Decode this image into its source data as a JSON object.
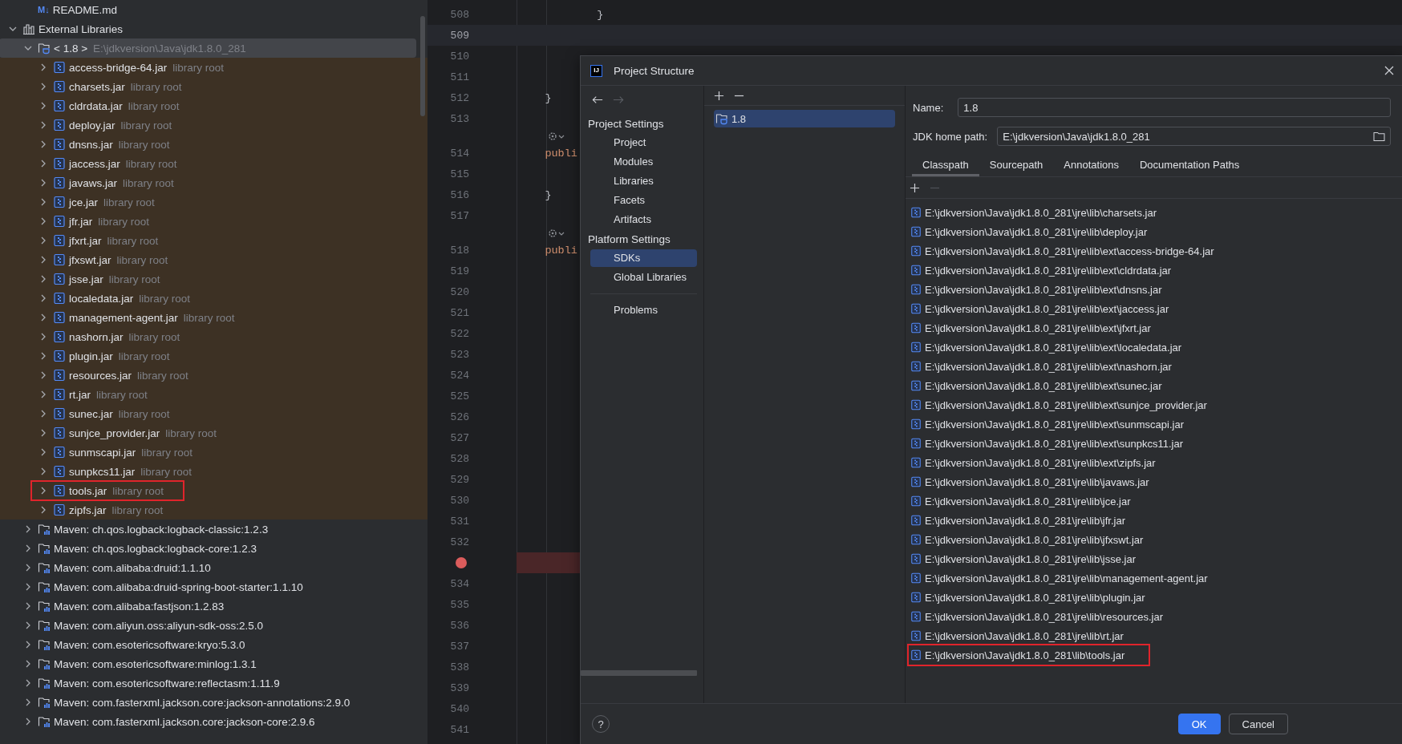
{
  "project_tree": {
    "files": [
      {
        "icon_text": "M↓",
        "label": "README.md"
      }
    ],
    "nodes": [
      {
        "label": "External Libraries",
        "kind": "libraries",
        "expanded": true,
        "selected": false,
        "children": [
          {
            "label": "< 1.8 >",
            "hint": "E:\\jdkversion\\Java\\jdk1.8.0_281",
            "kind": "sdk",
            "expanded": true,
            "selected": true,
            "children": [
              {
                "label": "access-bridge-64.jar",
                "hint": "library root",
                "kind": "jar",
                "expanded": false,
                "selected": false,
                "highlighted": false
              },
              {
                "label": "charsets.jar",
                "hint": "library root",
                "kind": "jar",
                "expanded": false,
                "selected": false,
                "highlighted": false
              },
              {
                "label": "cldrdata.jar",
                "hint": "library root",
                "kind": "jar",
                "expanded": false,
                "selected": false,
                "highlighted": false
              },
              {
                "label": "deploy.jar",
                "hint": "library root",
                "kind": "jar",
                "expanded": false,
                "selected": false,
                "highlighted": false
              },
              {
                "label": "dnsns.jar",
                "hint": "library root",
                "kind": "jar",
                "expanded": false,
                "selected": false,
                "highlighted": false
              },
              {
                "label": "jaccess.jar",
                "hint": "library root",
                "kind": "jar",
                "expanded": false,
                "selected": false,
                "highlighted": false
              },
              {
                "label": "javaws.jar",
                "hint": "library root",
                "kind": "jar",
                "expanded": false,
                "selected": false,
                "highlighted": false
              },
              {
                "label": "jce.jar",
                "hint": "library root",
                "kind": "jar",
                "expanded": false,
                "selected": false,
                "highlighted": false
              },
              {
                "label": "jfr.jar",
                "hint": "library root",
                "kind": "jar",
                "expanded": false,
                "selected": false,
                "highlighted": false
              },
              {
                "label": "jfxrt.jar",
                "hint": "library root",
                "kind": "jar",
                "expanded": false,
                "selected": false,
                "highlighted": false
              },
              {
                "label": "jfxswt.jar",
                "hint": "library root",
                "kind": "jar",
                "expanded": false,
                "selected": false,
                "highlighted": false
              },
              {
                "label": "jsse.jar",
                "hint": "library root",
                "kind": "jar",
                "expanded": false,
                "selected": false,
                "highlighted": false
              },
              {
                "label": "localedata.jar",
                "hint": "library root",
                "kind": "jar",
                "expanded": false,
                "selected": false,
                "highlighted": false
              },
              {
                "label": "management-agent.jar",
                "hint": "library root",
                "kind": "jar",
                "expanded": false,
                "selected": false,
                "highlighted": false
              },
              {
                "label": "nashorn.jar",
                "hint": "library root",
                "kind": "jar",
                "expanded": false,
                "selected": false,
                "highlighted": false
              },
              {
                "label": "plugin.jar",
                "hint": "library root",
                "kind": "jar",
                "expanded": false,
                "selected": false,
                "highlighted": false
              },
              {
                "label": "resources.jar",
                "hint": "library root",
                "kind": "jar",
                "expanded": false,
                "selected": false,
                "highlighted": false
              },
              {
                "label": "rt.jar",
                "hint": "library root",
                "kind": "jar",
                "expanded": false,
                "selected": false,
                "highlighted": false
              },
              {
                "label": "sunec.jar",
                "hint": "library root",
                "kind": "jar",
                "expanded": false,
                "selected": false,
                "highlighted": false
              },
              {
                "label": "sunjce_provider.jar",
                "hint": "library root",
                "kind": "jar",
                "expanded": false,
                "selected": false,
                "highlighted": false
              },
              {
                "label": "sunmscapi.jar",
                "hint": "library root",
                "kind": "jar",
                "expanded": false,
                "selected": false,
                "highlighted": false
              },
              {
                "label": "sunpkcs11.jar",
                "hint": "library root",
                "kind": "jar",
                "expanded": false,
                "selected": false,
                "highlighted": false
              },
              {
                "label": "tools.jar",
                "hint": "library root",
                "kind": "jar",
                "expanded": false,
                "selected": false,
                "highlighted": true
              },
              {
                "label": "zipfs.jar",
                "hint": "library root",
                "kind": "jar",
                "expanded": false,
                "selected": false,
                "highlighted": false
              }
            ]
          },
          {
            "label": "Maven: ch.qos.logback:logback-classic:1.2.3",
            "kind": "maven",
            "expanded": false,
            "selected": false
          },
          {
            "label": "Maven: ch.qos.logback:logback-core:1.2.3",
            "kind": "maven",
            "expanded": false,
            "selected": false
          },
          {
            "label": "Maven: com.alibaba:druid:1.1.10",
            "kind": "maven",
            "expanded": false,
            "selected": false
          },
          {
            "label": "Maven: com.alibaba:druid-spring-boot-starter:1.1.10",
            "kind": "maven",
            "expanded": false,
            "selected": false
          },
          {
            "label": "Maven: com.alibaba:fastjson:1.2.83",
            "kind": "maven",
            "expanded": false,
            "selected": false
          },
          {
            "label": "Maven: com.aliyun.oss:aliyun-sdk-oss:2.5.0",
            "kind": "maven",
            "expanded": false,
            "selected": false
          },
          {
            "label": "Maven: com.esotericsoftware:kryo:5.3.0",
            "kind": "maven",
            "expanded": false,
            "selected": false
          },
          {
            "label": "Maven: com.esotericsoftware:minlog:1.3.1",
            "kind": "maven",
            "expanded": false,
            "selected": false
          },
          {
            "label": "Maven: com.esotericsoftware:reflectasm:1.11.9",
            "kind": "maven",
            "expanded": false,
            "selected": false
          },
          {
            "label": "Maven: com.fasterxml.jackson.core:jackson-annotations:2.9.0",
            "kind": "maven",
            "expanded": false,
            "selected": false
          },
          {
            "label": "Maven: com.fasterxml.jackson.core:jackson-core:2.9.6",
            "kind": "maven",
            "expanded": false,
            "selected": false
          }
        ]
      }
    ]
  },
  "editor": {
    "lines": [
      {
        "kind": "line",
        "number": "508",
        "code": "            }",
        "current": false,
        "breakpoint": false
      },
      {
        "kind": "line",
        "number": "509",
        "current": true,
        "breakpoint": false
      },
      {
        "kind": "line",
        "number": "510",
        "current": false,
        "breakpoint": false
      },
      {
        "kind": "line",
        "number": "511",
        "current": false,
        "breakpoint": false
      },
      {
        "kind": "line",
        "number": "512",
        "code": "    }",
        "current": false,
        "breakpoint": false
      },
      {
        "kind": "line",
        "number": "513",
        "current": false,
        "breakpoint": false
      },
      {
        "kind": "inlay"
      },
      {
        "kind": "line",
        "number": "514",
        "code": "    publi",
        "current": false,
        "breakpoint": false
      },
      {
        "kind": "line",
        "number": "515",
        "current": false,
        "breakpoint": false
      },
      {
        "kind": "line",
        "number": "516",
        "code": "    }",
        "current": false,
        "breakpoint": false
      },
      {
        "kind": "line",
        "number": "517",
        "current": false,
        "breakpoint": false
      },
      {
        "kind": "inlay"
      },
      {
        "kind": "line",
        "number": "518",
        "code": "    publi",
        "current": false,
        "breakpoint": false
      },
      {
        "kind": "line",
        "number": "519",
        "current": false,
        "breakpoint": false
      },
      {
        "kind": "line",
        "number": "520",
        "current": false,
        "breakpoint": false
      },
      {
        "kind": "line",
        "number": "521",
        "current": false,
        "breakpoint": false
      },
      {
        "kind": "line",
        "number": "522",
        "current": false,
        "breakpoint": false
      },
      {
        "kind": "line",
        "number": "523",
        "current": false,
        "breakpoint": false
      },
      {
        "kind": "line",
        "number": "524",
        "current": false,
        "breakpoint": false
      },
      {
        "kind": "line",
        "number": "525",
        "current": false,
        "breakpoint": false
      },
      {
        "kind": "line",
        "number": "526",
        "current": false,
        "breakpoint": false
      },
      {
        "kind": "line",
        "number": "527",
        "current": false,
        "breakpoint": false
      },
      {
        "kind": "line",
        "number": "528",
        "current": false,
        "breakpoint": false
      },
      {
        "kind": "line",
        "number": "529",
        "current": false,
        "breakpoint": false
      },
      {
        "kind": "line",
        "number": "530",
        "current": false,
        "breakpoint": false
      },
      {
        "kind": "line",
        "number": "531",
        "current": false,
        "breakpoint": false
      },
      {
        "kind": "line",
        "number": "532",
        "current": false,
        "breakpoint": false
      },
      {
        "kind": "line",
        "current": false,
        "breakpoint": true
      },
      {
        "kind": "line",
        "number": "534",
        "current": false,
        "breakpoint": false
      },
      {
        "kind": "line",
        "number": "535",
        "current": false,
        "breakpoint": false
      },
      {
        "kind": "line",
        "number": "536",
        "current": false,
        "breakpoint": false
      },
      {
        "kind": "line",
        "number": "537",
        "current": false,
        "breakpoint": false
      },
      {
        "kind": "line",
        "number": "538",
        "current": false,
        "breakpoint": false
      },
      {
        "kind": "line",
        "number": "539",
        "current": false,
        "breakpoint": false
      },
      {
        "kind": "line",
        "number": "540",
        "current": false,
        "breakpoint": false
      },
      {
        "kind": "line",
        "number": "541",
        "current": false,
        "breakpoint": false
      }
    ]
  },
  "dialog": {
    "logo_text": "IJ",
    "title": "Project Structure",
    "history": {
      "back_enabled": true,
      "forward_enabled": false
    },
    "nav": [
      {
        "heading": "Project Settings",
        "items": [
          {
            "label": "Project",
            "selected": false
          },
          {
            "label": "Modules",
            "selected": false
          },
          {
            "label": "Libraries",
            "selected": false
          },
          {
            "label": "Facets",
            "selected": false
          },
          {
            "label": "Artifacts",
            "selected": false
          }
        ]
      },
      {
        "heading": "Platform Settings",
        "items": [
          {
            "label": "SDKs",
            "selected": true
          },
          {
            "label": "Global Libraries",
            "selected": false
          }
        ]
      },
      {
        "items": [
          {
            "label": "Problems",
            "selected": false
          }
        ]
      }
    ],
    "sdk_toolbar": {
      "remove_enabled": true
    },
    "sdk_list": [
      {
        "label": "1.8",
        "selected": true
      }
    ],
    "name_field": {
      "label": "Name:",
      "value": "1.8"
    },
    "home_path_field": {
      "label": "JDK home path:",
      "value": "E:\\jdkversion\\Java\\jdk1.8.0_281"
    },
    "tabs": [
      {
        "label": "Classpath",
        "selected": true
      },
      {
        "label": "Sourcepath",
        "selected": false
      },
      {
        "label": "Annotations",
        "selected": false
      },
      {
        "label": "Documentation Paths",
        "selected": false
      }
    ],
    "classpath_toolbar": {
      "remove_enabled": false
    },
    "classpath": [
      {
        "path": "E:\\jdkversion\\Java\\jdk1.8.0_281\\jre\\lib\\charsets.jar",
        "highlighted": false
      },
      {
        "path": "E:\\jdkversion\\Java\\jdk1.8.0_281\\jre\\lib\\deploy.jar",
        "highlighted": false
      },
      {
        "path": "E:\\jdkversion\\Java\\jdk1.8.0_281\\jre\\lib\\ext\\access-bridge-64.jar",
        "highlighted": false
      },
      {
        "path": "E:\\jdkversion\\Java\\jdk1.8.0_281\\jre\\lib\\ext\\cldrdata.jar",
        "highlighted": false
      },
      {
        "path": "E:\\jdkversion\\Java\\jdk1.8.0_281\\jre\\lib\\ext\\dnsns.jar",
        "highlighted": false
      },
      {
        "path": "E:\\jdkversion\\Java\\jdk1.8.0_281\\jre\\lib\\ext\\jaccess.jar",
        "highlighted": false
      },
      {
        "path": "E:\\jdkversion\\Java\\jdk1.8.0_281\\jre\\lib\\ext\\jfxrt.jar",
        "highlighted": false
      },
      {
        "path": "E:\\jdkversion\\Java\\jdk1.8.0_281\\jre\\lib\\ext\\localedata.jar",
        "highlighted": false
      },
      {
        "path": "E:\\jdkversion\\Java\\jdk1.8.0_281\\jre\\lib\\ext\\nashorn.jar",
        "highlighted": false
      },
      {
        "path": "E:\\jdkversion\\Java\\jdk1.8.0_281\\jre\\lib\\ext\\sunec.jar",
        "highlighted": false
      },
      {
        "path": "E:\\jdkversion\\Java\\jdk1.8.0_281\\jre\\lib\\ext\\sunjce_provider.jar",
        "highlighted": false
      },
      {
        "path": "E:\\jdkversion\\Java\\jdk1.8.0_281\\jre\\lib\\ext\\sunmscapi.jar",
        "highlighted": false
      },
      {
        "path": "E:\\jdkversion\\Java\\jdk1.8.0_281\\jre\\lib\\ext\\sunpkcs11.jar",
        "highlighted": false
      },
      {
        "path": "E:\\jdkversion\\Java\\jdk1.8.0_281\\jre\\lib\\ext\\zipfs.jar",
        "highlighted": false
      },
      {
        "path": "E:\\jdkversion\\Java\\jdk1.8.0_281\\jre\\lib\\javaws.jar",
        "highlighted": false
      },
      {
        "path": "E:\\jdkversion\\Java\\jdk1.8.0_281\\jre\\lib\\jce.jar",
        "highlighted": false
      },
      {
        "path": "E:\\jdkversion\\Java\\jdk1.8.0_281\\jre\\lib\\jfr.jar",
        "highlighted": false
      },
      {
        "path": "E:\\jdkversion\\Java\\jdk1.8.0_281\\jre\\lib\\jfxswt.jar",
        "highlighted": false
      },
      {
        "path": "E:\\jdkversion\\Java\\jdk1.8.0_281\\jre\\lib\\jsse.jar",
        "highlighted": false
      },
      {
        "path": "E:\\jdkversion\\Java\\jdk1.8.0_281\\jre\\lib\\management-agent.jar",
        "highlighted": false
      },
      {
        "path": "E:\\jdkversion\\Java\\jdk1.8.0_281\\jre\\lib\\plugin.jar",
        "highlighted": false
      },
      {
        "path": "E:\\jdkversion\\Java\\jdk1.8.0_281\\jre\\lib\\resources.jar",
        "highlighted": false
      },
      {
        "path": "E:\\jdkversion\\Java\\jdk1.8.0_281\\jre\\lib\\rt.jar",
        "highlighted": false
      },
      {
        "path": "E:\\jdkversion\\Java\\jdk1.8.0_281\\lib\\tools.jar",
        "highlighted": true
      }
    ],
    "help": "?",
    "buttons": [
      {
        "label": "OK",
        "kind": "primary"
      },
      {
        "label": "Cancel",
        "kind": "secondary"
      }
    ]
  }
}
